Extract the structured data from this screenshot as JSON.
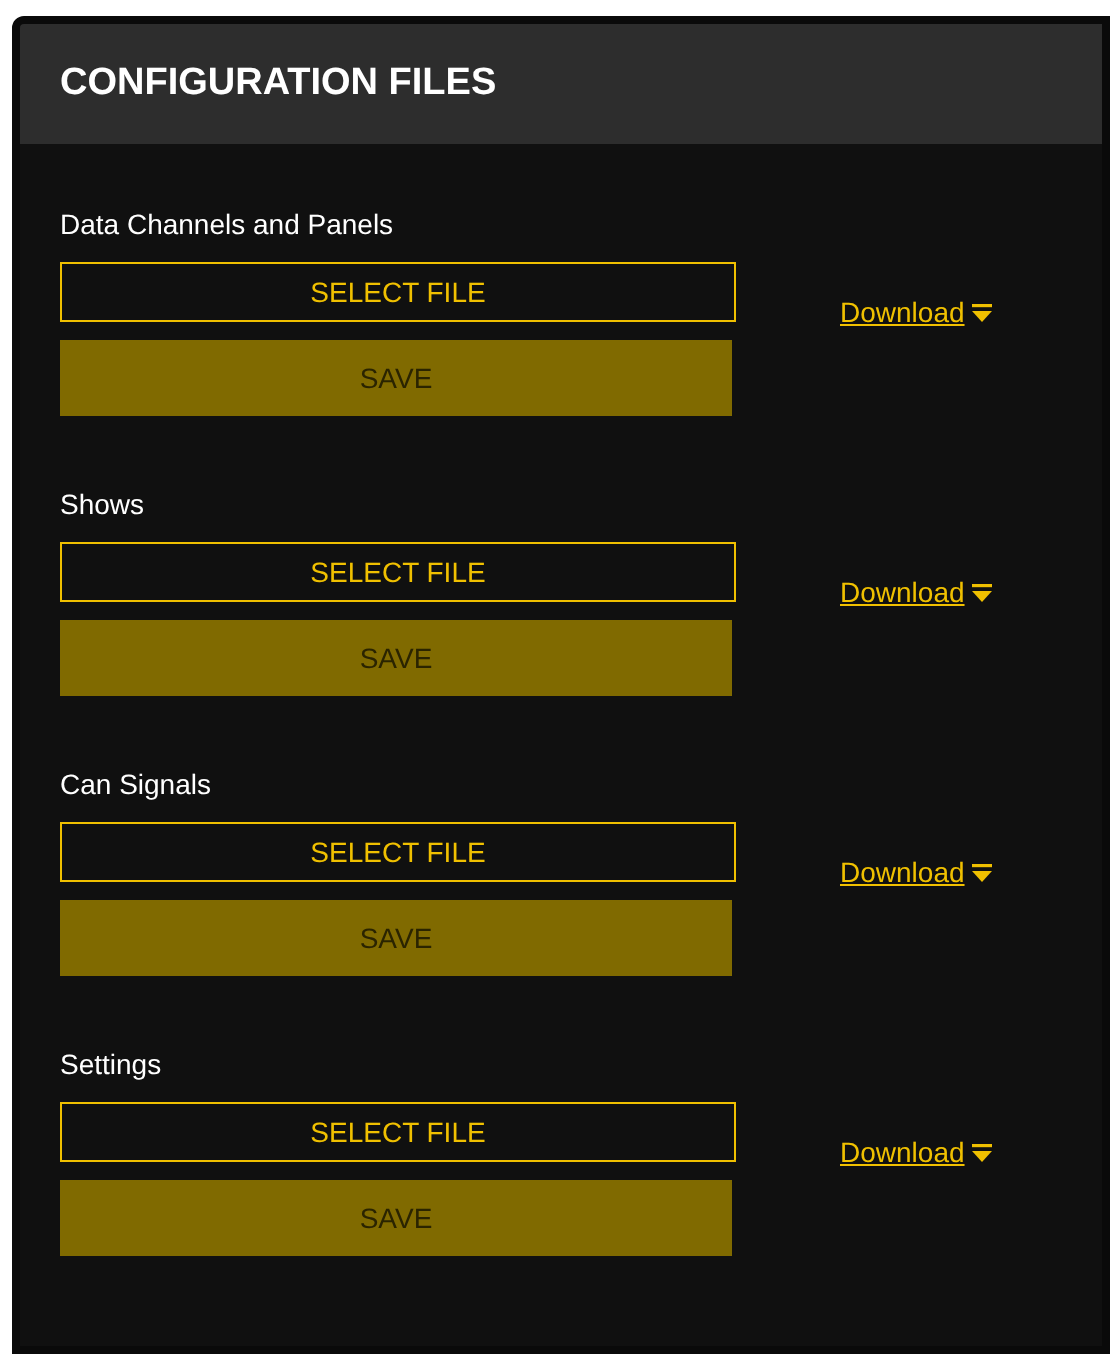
{
  "panel": {
    "title": "CONFIGURATION FILES"
  },
  "sections": [
    {
      "label": "Data Channels and Panels",
      "select_button": "SELECT FILE",
      "save_button": {
        "label": "SAVE",
        "disabled": true
      },
      "download_link": "Download"
    },
    {
      "label": "Shows",
      "select_button": "SELECT FILE",
      "save_button": {
        "label": "SAVE",
        "disabled": true
      },
      "download_link": "Download"
    },
    {
      "label": "Can Signals",
      "select_button": "SELECT FILE",
      "save_button": {
        "label": "SAVE",
        "disabled": true
      },
      "download_link": "Download"
    },
    {
      "label": "Settings",
      "select_button": "SELECT FILE",
      "save_button": {
        "label": "SAVE",
        "disabled": true
      },
      "download_link": "Download"
    }
  ]
}
